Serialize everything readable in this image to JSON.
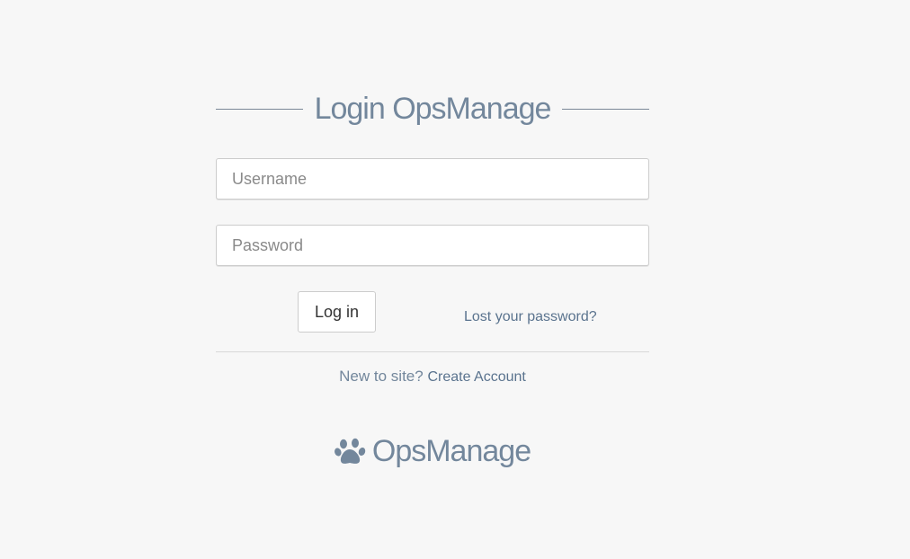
{
  "login": {
    "title": "Login OpsManage",
    "username_placeholder": "Username",
    "password_placeholder": "Password",
    "login_button": "Log in",
    "lost_password": "Lost your password?",
    "signup_prompt": "New to site?",
    "create_account": "Create Account"
  },
  "brand": {
    "name": "OpsManage",
    "icon": "paw-icon"
  },
  "colors": {
    "background": "#f7f7f7",
    "text_muted": "#73879c",
    "link": "#5a738e"
  }
}
